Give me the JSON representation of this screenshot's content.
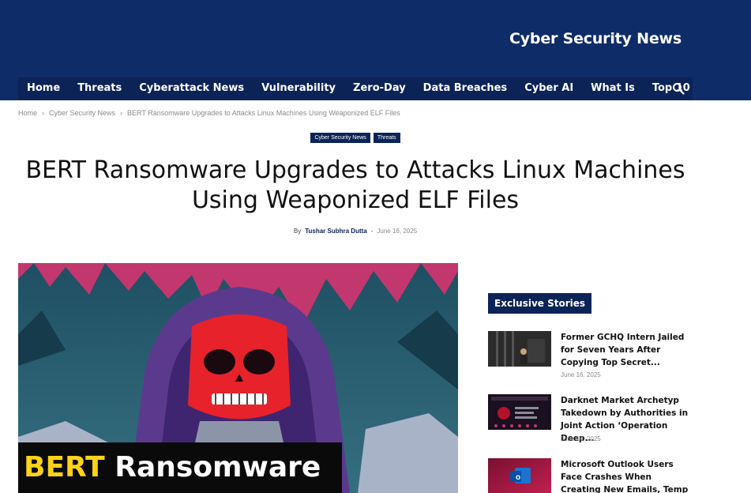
{
  "site": {
    "logo_text": "Cyber Security News"
  },
  "nav": {
    "items": [
      "Home",
      "Threats",
      "Cyberattack News",
      "Vulnerability",
      "Zero-Day",
      "Data Breaches",
      "Cyber AI",
      "What Is",
      "Top 10"
    ],
    "search_icon": "search-icon"
  },
  "breadcrumb": [
    "Home",
    "Cyber Security News",
    "BERT Ransomware Upgrades to Attacks Linux Machines Using Weaponized ELF Files"
  ],
  "article": {
    "categories": [
      "Cyber Security News",
      "Threats"
    ],
    "title": "BERT Ransomware Upgrades to Attacks Linux Machines Using Weaponized ELF Files",
    "by": "By",
    "author": "Tushar Subhra Dutta",
    "dash": "-",
    "date": "June 16, 2025",
    "hero_banner_word1": "BERT",
    "hero_banner_word2": "Ransomware"
  },
  "sidebar": {
    "title": "Exclusive Stories",
    "stories": [
      {
        "headline": "Former GCHQ Intern Jailed for Seven Years After Copying Top Secret...",
        "date": "June 16, 2025"
      },
      {
        "headline": "Darknet Market Archetyp Takedown by Authorities in Joint Action ‘Operation Deep...",
        "date": "June 16, 2025"
      },
      {
        "headline": "Microsoft Outlook Users Face Crashes When Creating New Emails, Temp Fix...",
        "date": ""
      }
    ]
  },
  "colors": {
    "brand_navy": "#0b2357",
    "header_bg": "#0e2c68",
    "banner_yellow": "#ffd21a"
  }
}
